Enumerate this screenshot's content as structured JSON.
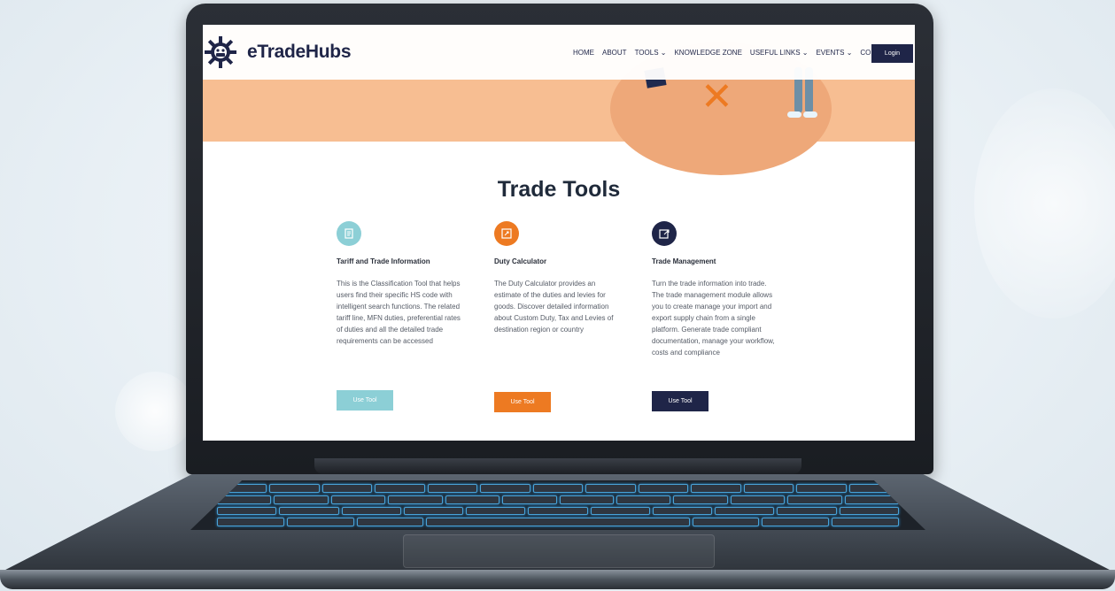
{
  "site": {
    "brand": "eTradeHubs",
    "nav": [
      "HOME",
      "ABOUT",
      "TOOLS ⌄",
      "KNOWLEDGE ZONE",
      "USEFUL LINKS ⌄",
      "EVENTS ⌄",
      "CONTACT"
    ],
    "login": "Login"
  },
  "main": {
    "title": "Trade Tools",
    "cards": [
      {
        "heading": "Tariff and Trade Information",
        "description": "This is the Classification Tool that helps users find their specific HS code with intelligent search functions. The related tariff line, MFN duties, preferential rates of duties and all the detailed trade requirements can be accessed",
        "button": "Use Tool",
        "color": "#8ccfd6",
        "icon": "document-icon"
      },
      {
        "heading": "Duty Calculator",
        "description": "The Duty Calculator provides an estimate of the duties and levies for goods. Discover detailed information about Custom Duty, Tax and Levies of destination region or country",
        "button": "Use Tool",
        "color": "#ed7a22",
        "icon": "calculator-icon"
      },
      {
        "heading": "Trade Management",
        "description": "Turn the trade information into trade. The trade management module allows you to create manage your import and export supply chain from a single platform. Generate trade compliant documentation, manage your workflow, costs and compliance",
        "button": "Use Tool",
        "color": "#1f2548",
        "icon": "export-icon"
      }
    ]
  },
  "colors": {
    "hero": "#f7be92",
    "navy": "#1f2548",
    "orange": "#ed7a22",
    "teal": "#8ccfd6"
  }
}
